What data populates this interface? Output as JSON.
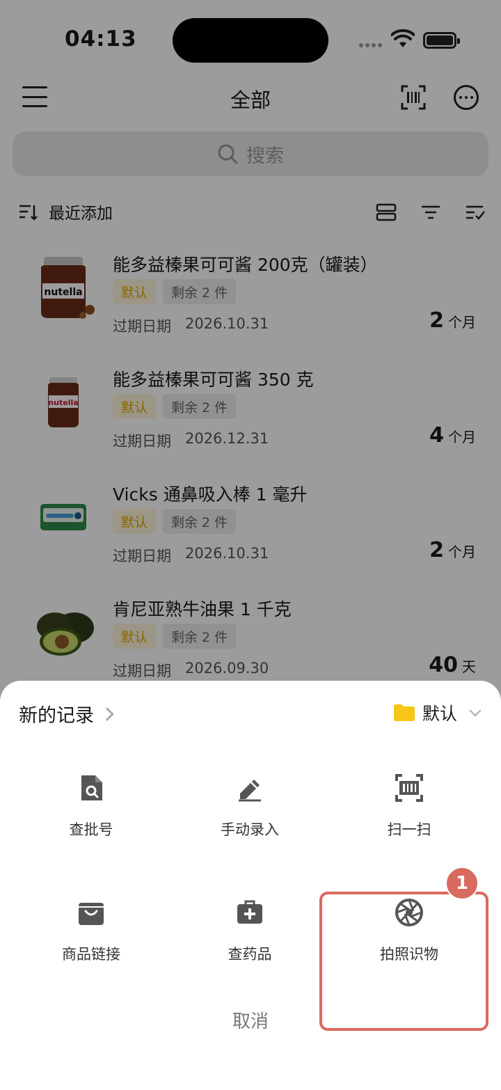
{
  "status": {
    "time": "04:13"
  },
  "header": {
    "title": "全部"
  },
  "search": {
    "placeholder": "搜索"
  },
  "sort": {
    "label": "最近添加"
  },
  "items": [
    {
      "name": "能多益榛果可可酱 200克（罐装）",
      "tag": "默认",
      "remain": "剩余 2 件",
      "exp_label": "过期日期",
      "exp_date": "2026.10.31",
      "count": "2",
      "unit": "个月",
      "image": "nutella-jar-icon"
    },
    {
      "name": "能多益榛果可可酱 350 克",
      "tag": "默认",
      "remain": "剩余 2 件",
      "exp_label": "过期日期",
      "exp_date": "2026.12.31",
      "count": "4",
      "unit": "个月",
      "image": "nutella-small-jar-icon"
    },
    {
      "name": "Vicks 通鼻吸入棒 1 毫升",
      "tag": "默认",
      "remain": "剩余 2 件",
      "exp_label": "过期日期",
      "exp_date": "2026.10.31",
      "count": "2",
      "unit": "个月",
      "image": "vicks-inhaler-icon"
    },
    {
      "name": "肯尼亚熟牛油果 1 千克",
      "tag": "默认",
      "remain": "剩余 2 件",
      "exp_label": "过期日期",
      "exp_date": "2026.09.30",
      "count": "40",
      "unit": "天",
      "image": "avocado-icon"
    }
  ],
  "sheet": {
    "title": "新的记录",
    "folder": "默认",
    "actions": [
      {
        "label": "查批号",
        "icon": "file-search-icon"
      },
      {
        "label": "手动录入",
        "icon": "pencil-icon"
      },
      {
        "label": "扫一扫",
        "icon": "scan-icon"
      },
      {
        "label": "商品链接",
        "icon": "shopping-bag-icon"
      },
      {
        "label": "查药品",
        "icon": "medical-kit-icon"
      },
      {
        "label": "拍照识物",
        "icon": "camera-aperture-icon"
      }
    ],
    "cancel": "取消"
  },
  "annotation": {
    "badge": "1"
  },
  "colors": {
    "accent_yellow": "#f5c518",
    "highlight_red": "#d96a5f"
  }
}
